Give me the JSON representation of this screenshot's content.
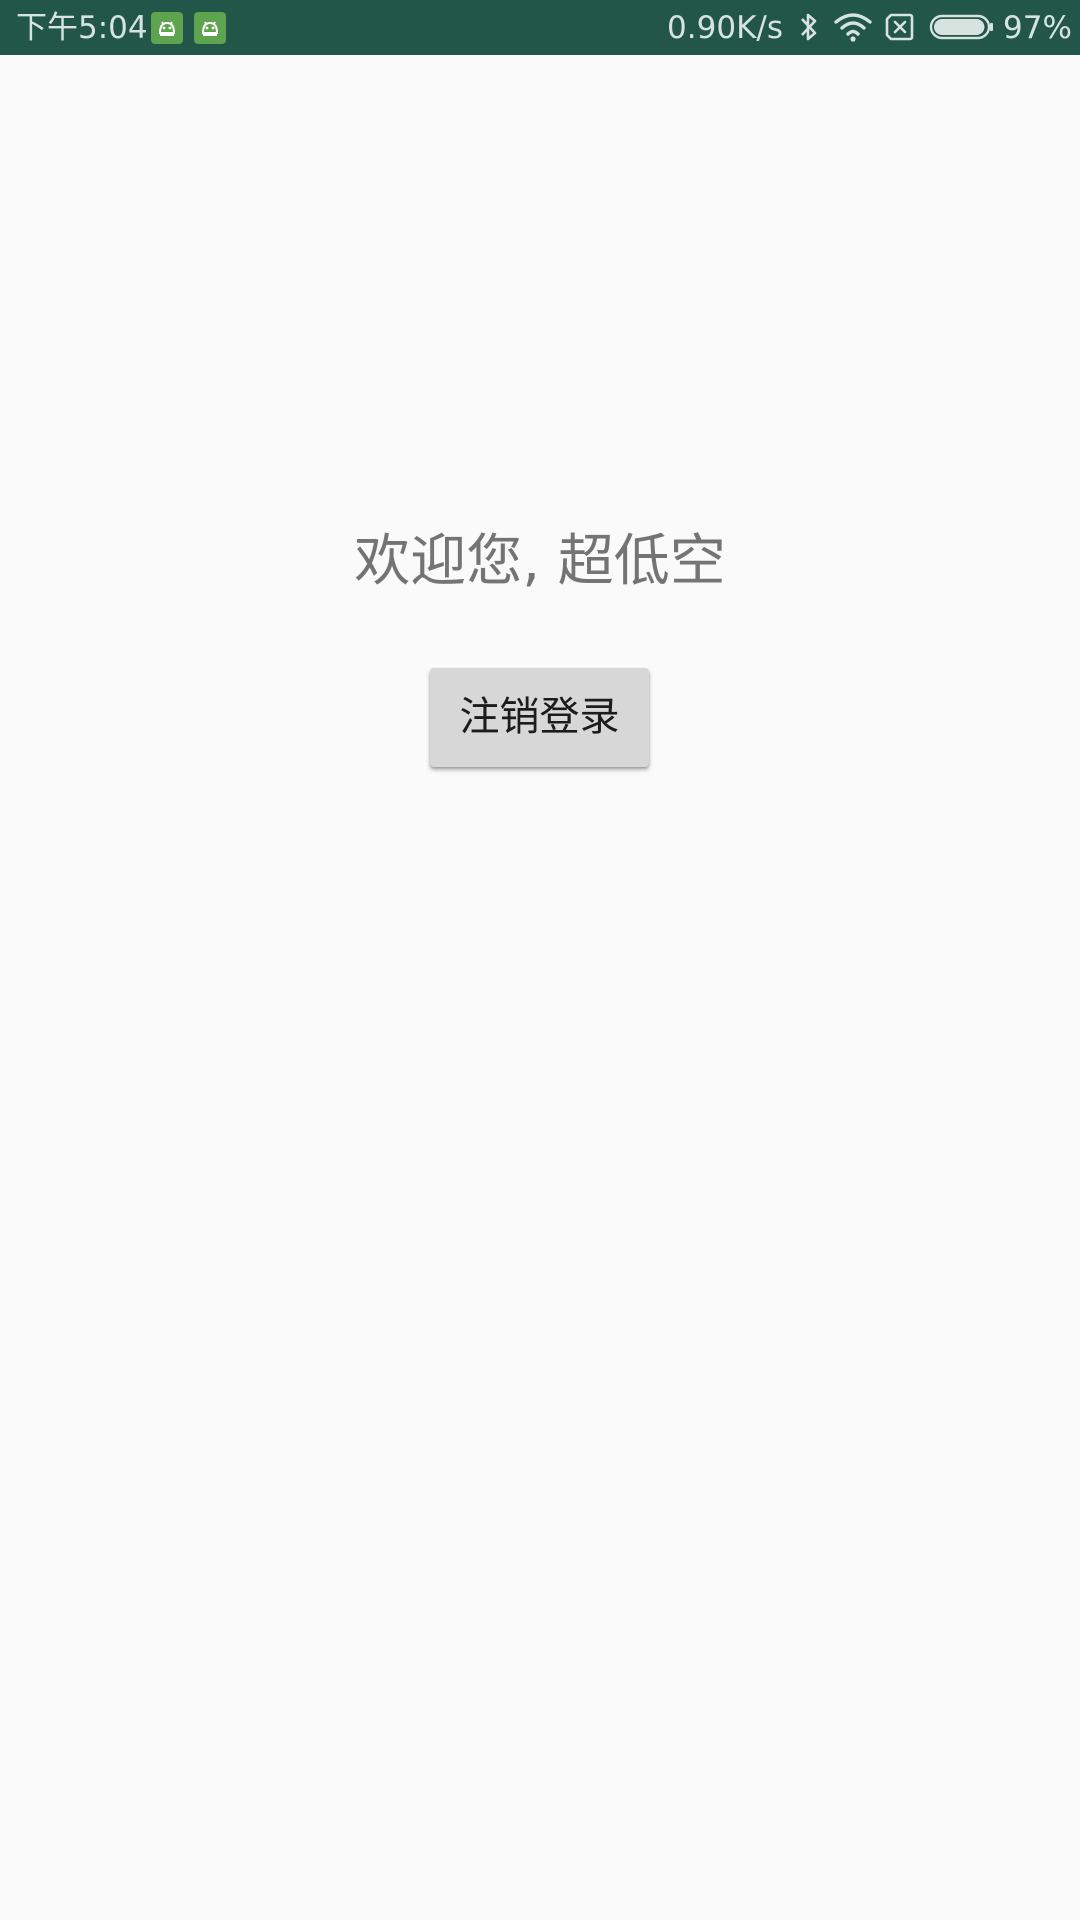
{
  "status_bar": {
    "time": "下午5:04",
    "notification_icons": [
      "android-app-icon",
      "android-app-icon"
    ],
    "network_speed": "0.90K/s",
    "icons": [
      "bluetooth-icon",
      "wifi-icon",
      "no-sim-icon",
      "battery-icon"
    ],
    "battery_percent": "97%",
    "battery_level": 0.97,
    "colors": {
      "background": "#225649",
      "foreground": "#d7e3df",
      "notification_badge": "#5ea44f"
    }
  },
  "main": {
    "welcome_text": "欢迎您, 超低空",
    "logout_button_label": "注销登录"
  },
  "colors": {
    "page_background": "#fafafa",
    "welcome_text": "#747474",
    "button_background": "#d7d7d7",
    "button_text": "#1c1c1c"
  }
}
